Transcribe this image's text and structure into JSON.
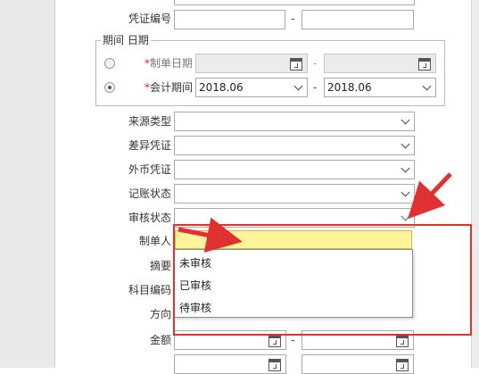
{
  "fields": {
    "voucher_no": {
      "label": "凭证编号",
      "separator": "-"
    },
    "period_group": {
      "legend": "期间 日期"
    },
    "voucher_date": {
      "required_mark": "*",
      "label": "制单日期",
      "separator": "-"
    },
    "accounting_period": {
      "required_mark": "*",
      "label": "会计期间",
      "from": "2018.06",
      "to": "2018.06",
      "separator": "-"
    },
    "source_type": {
      "label": "来源类型"
    },
    "diff_voucher": {
      "label": "差异凭证"
    },
    "fc_voucher": {
      "label": "外币凭证"
    },
    "posting_status": {
      "label": "记账状态"
    },
    "audit_status": {
      "label": "审核状态"
    },
    "creator": {
      "label": "制单人"
    },
    "summary": {
      "label": "摘要"
    },
    "account_code": {
      "label": "科目编码"
    },
    "direction": {
      "label": "方向"
    },
    "amount": {
      "label": "金额",
      "separator": "-"
    }
  },
  "audit_dropdown": {
    "options": [
      "未审核",
      "已审核",
      "待审核"
    ]
  },
  "colors": {
    "annotation_red": "#e03030",
    "highlight_yellow": "#fff49a"
  }
}
